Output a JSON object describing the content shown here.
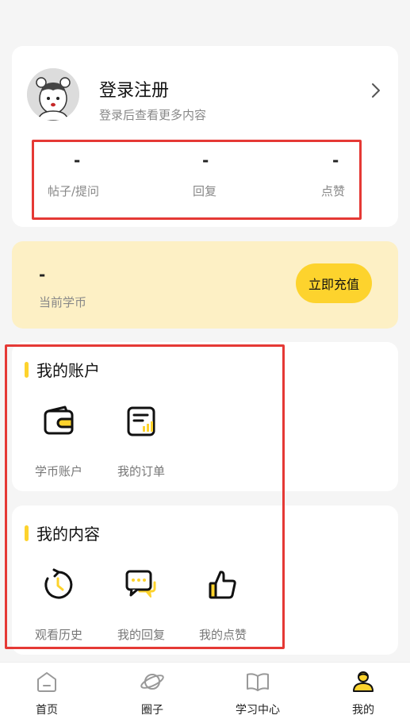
{
  "profile": {
    "title": "登录注册",
    "subtitle": "登录后查看更多内容",
    "stats": [
      {
        "value": "-",
        "label": "帖子/提问"
      },
      {
        "value": "-",
        "label": "回复"
      },
      {
        "value": "-",
        "label": "点赞"
      }
    ]
  },
  "coins": {
    "value": "-",
    "label": "当前学币",
    "button": "立即充值"
  },
  "account": {
    "title": "我的账户",
    "items": [
      {
        "label": "学币账户",
        "icon": "wallet-icon"
      },
      {
        "label": "我的订单",
        "icon": "order-icon"
      }
    ]
  },
  "content": {
    "title": "我的内容",
    "items": [
      {
        "label": "观看历史",
        "icon": "history-icon"
      },
      {
        "label": "我的回复",
        "icon": "reply-icon"
      },
      {
        "label": "我的点赞",
        "icon": "thumbs-up-icon"
      }
    ]
  },
  "tabs": [
    {
      "label": "首页",
      "icon": "home-icon"
    },
    {
      "label": "圈子",
      "icon": "planet-icon"
    },
    {
      "label": "学习中心",
      "icon": "book-icon"
    },
    {
      "label": "我的",
      "icon": "profile-icon"
    }
  ],
  "colors": {
    "accent": "#fdd32d",
    "coin_bg": "#fdf0c5",
    "highlight_box": "#e53935"
  }
}
